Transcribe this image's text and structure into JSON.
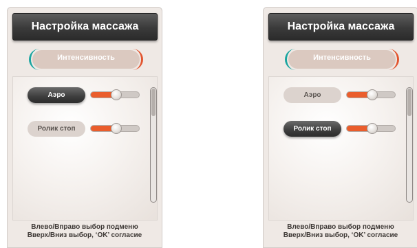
{
  "panels": [
    {
      "title": "Настройка массажа",
      "tab_label": "Интенсивность",
      "items": [
        {
          "label": "Аэро",
          "selected": true,
          "level": 0.53
        },
        {
          "label": "Ролик стоп",
          "selected": false,
          "level": 0.53
        }
      ],
      "help_line1": "Влево/Вправо выбор подменю",
      "help_line2": "Вверх/Вниз выбор, ‘OK’ согласие"
    },
    {
      "title": "Настройка массажа",
      "tab_label": "Интенсивность",
      "items": [
        {
          "label": "Аэро",
          "selected": false,
          "level": 0.53
        },
        {
          "label": "Ролик стоп",
          "selected": true,
          "level": 0.53
        }
      ],
      "help_line1": "Влево/Вправо выбор подменю",
      "help_line2": "Вверх/Вниз выбор, ‘OK’ согласие"
    }
  ],
  "colors": {
    "accent_orange": "#ea5d2c",
    "accent_teal": "#1aa5a0",
    "title_dark": "#3a3a3a",
    "panel_bg": "#efe9e5"
  }
}
